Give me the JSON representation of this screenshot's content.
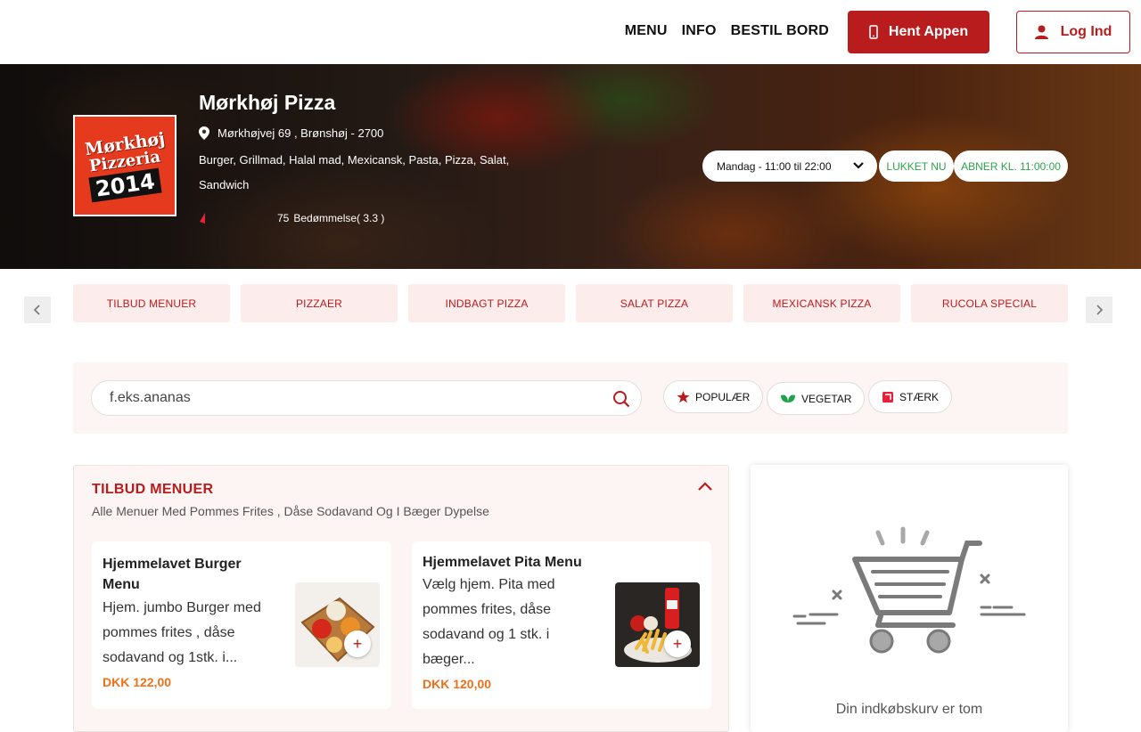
{
  "nav": {
    "links": [
      "MENU",
      "INFO",
      "BESTIL BORD"
    ],
    "app_button": "Hent Appen",
    "login_button": "Log Ind"
  },
  "restaurant": {
    "name": "Mørkhøj Pizza",
    "logo": {
      "line1": "Mørkhøj",
      "line2": "Pizzeria",
      "line3": "2014"
    },
    "address": "Mørkhøjvej 69 , Brønshøj - 2700",
    "categories": "Burger, Grillmad, Halal mad, Mexicansk, Pasta, Pizza, Salat, Sandwich",
    "rating_count": "75",
    "rating_label": "Bedømmelse( 3.3 )",
    "rating_value": 3.3,
    "hours_selected": "Mandag - 11:00 til 22:00",
    "status_closed": "LUKKET NU",
    "status_opens": "ABNER KL. 11:00:00"
  },
  "categories": [
    "TILBUD MENUER",
    "PIZZAER",
    "INDBAGT PIZZA",
    "SALAT PIZZA",
    "MEXICANSK PIZZA",
    "RUCOLA SPECIAL"
  ],
  "search": {
    "placeholder": "f.eks.ananas",
    "filters": [
      "POPULÆR",
      "VEGETAR",
      "STÆRK"
    ]
  },
  "section": {
    "title": "TILBUD MENUER",
    "subtitle": "Alle Menuer Med Pommes Frites , Dåse Sodavand Og I Bæger Dypelse",
    "items": [
      {
        "title": "Hjemmelavet Burger Menu",
        "desc": "Hjem. jumbo Burger med pommes frites , dåse sodavand og 1stk. i...",
        "price": "DKK 122,00"
      },
      {
        "title": "Hjemmelavet Pita Menu",
        "desc": "Vælg hjem. Pita med pommes frites, dåse sodavand og 1 stk. i bæger...",
        "price": "DKK 120,00"
      }
    ]
  },
  "cart": {
    "empty_text": "Din indkøbskurv er tom"
  },
  "colors": {
    "accent": "#b81c1c",
    "price": "#f0701a",
    "status_green": "#2aa34a",
    "tab_bg": "#fdecec"
  }
}
